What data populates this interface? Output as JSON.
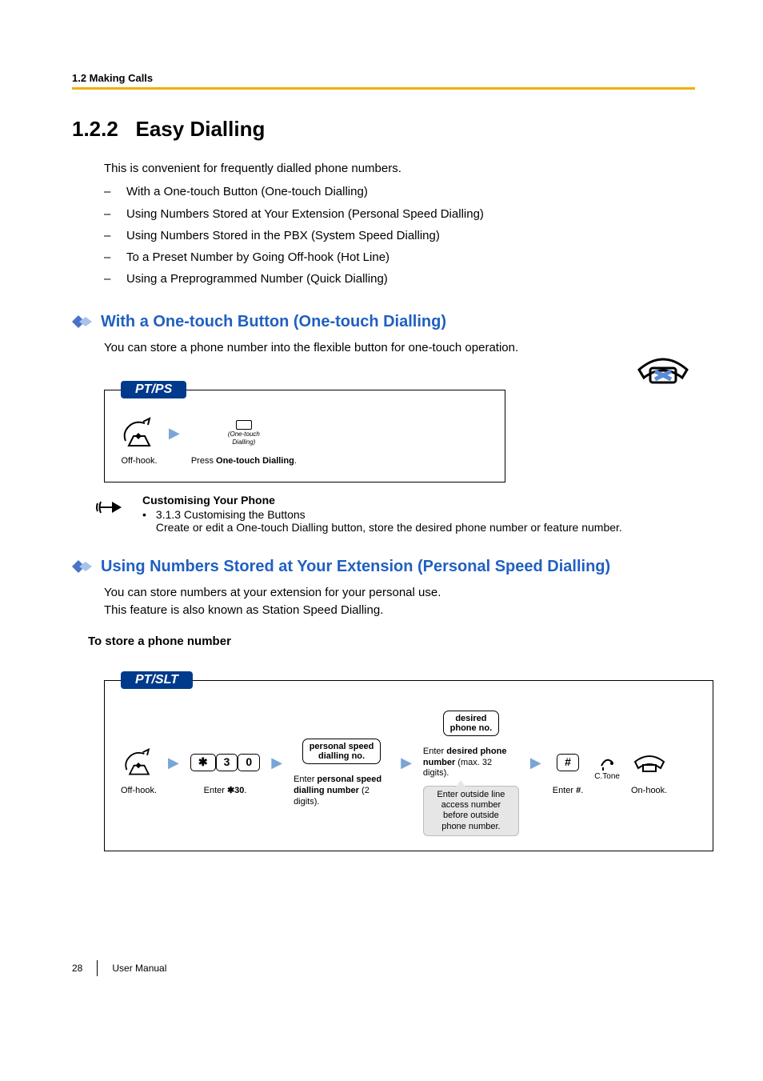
{
  "header": {
    "running": "1.2 Making Calls"
  },
  "title": {
    "num": "1.2.2",
    "text": "Easy Dialling"
  },
  "intro": {
    "lead": "This is convenient for frequently dialled phone numbers.",
    "items": [
      "With a One-touch Button (One-touch Dialling)",
      "Using Numbers Stored at Your Extension (Personal Speed Dialling)",
      "Using Numbers Stored in the PBX (System Speed Dialling)",
      "To a Preset Number by Going Off-hook (Hot Line)",
      "Using a Preprogrammed Number (Quick Dialling)"
    ]
  },
  "sec1": {
    "heading": "With a One-touch Button (One-touch Dialling)",
    "body": "You can store a phone number into the flexible button for one-touch operation.",
    "box_label": "PT/PS",
    "step1": "Off-hook.",
    "btn_label1": "(One-touch",
    "btn_label2": "Dialling)",
    "step2a": "Press ",
    "step2b": "One-touch Dialling",
    "step2c": "."
  },
  "note": {
    "title": "Customising Your Phone",
    "line1": "3.1.3 Customising the Buttons",
    "line2": "Create or edit a One-touch Dialling button, store the desired phone number or feature number."
  },
  "sec2": {
    "heading": "Using Numbers Stored at Your Extension (Personal Speed Dialling)",
    "body1": "You can store numbers at your extension for your personal use.",
    "body2": "This feature is also known as Station Speed Dialling.",
    "sub": "To store a phone number",
    "box_label": "PT/SLT",
    "s1": "Off-hook.",
    "keys": {
      "star": "✱",
      "k3": "3",
      "k0": "0",
      "hash": "#"
    },
    "s2a": "Enter ",
    "s2b": "✱30",
    "s2c": ".",
    "box_psd1": "personal speed",
    "box_psd2": "dialling no.",
    "s3a": "Enter ",
    "s3b": "personal speed dialling number",
    "s3c": " (2 digits).",
    "box_des1": "desired",
    "box_des2": "phone no.",
    "s4a": "Enter ",
    "s4b": "desired phone number",
    "s4c": " (max. 32 digits).",
    "callout": "Enter outside line access number before outside phone number.",
    "s5a": "Enter ",
    "s5b": "#",
    "s5c": ".",
    "ctone": "C.Tone",
    "s6": "On-hook."
  },
  "footer": {
    "page": "28",
    "label": "User Manual"
  }
}
